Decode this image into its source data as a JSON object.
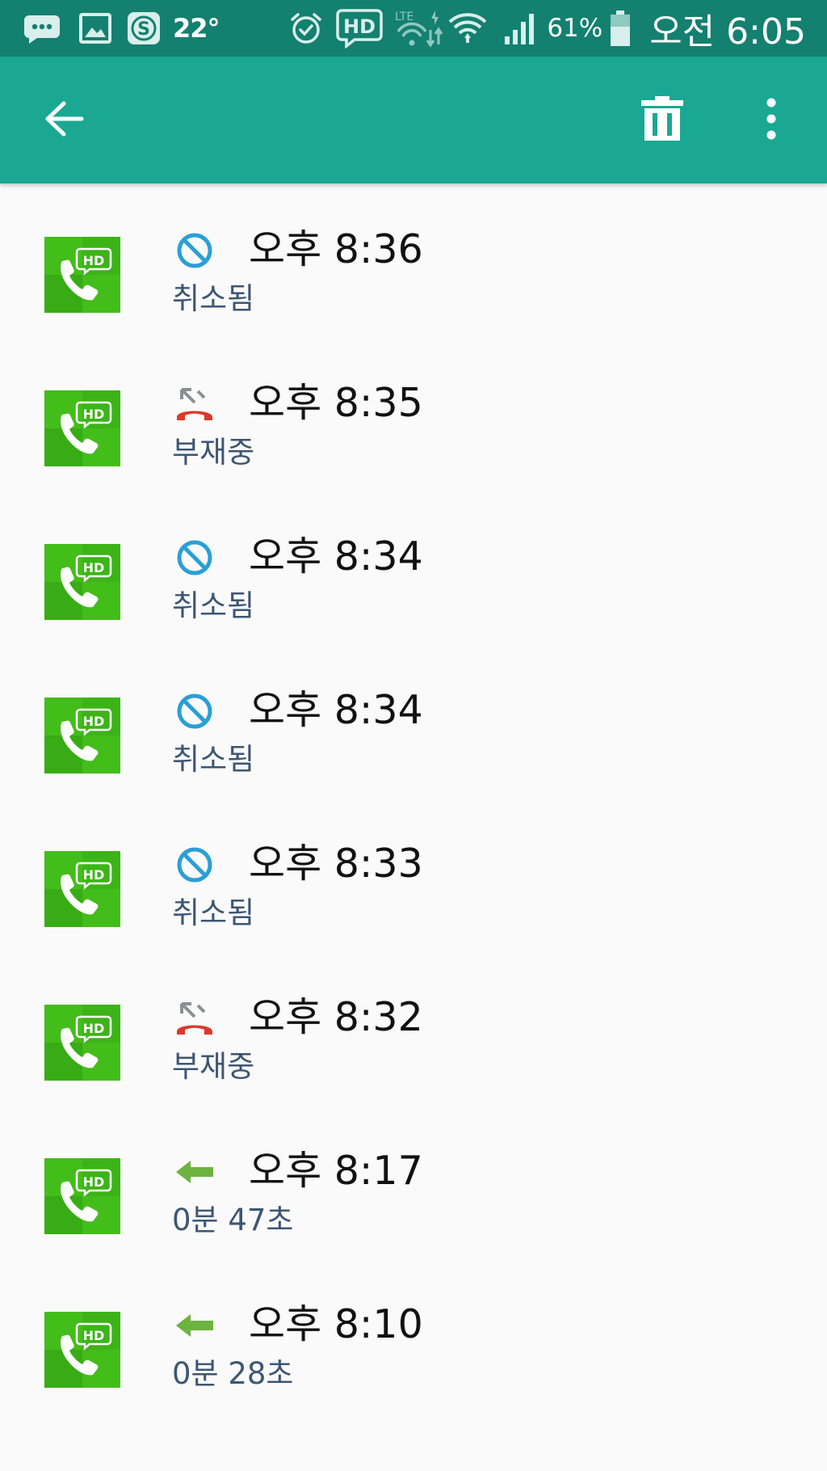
{
  "status_bar": {
    "temperature": "22°",
    "battery_percent": "61%",
    "clock": "오전 6:05",
    "network_label": "LTE",
    "hd_label": "HD",
    "battery_level": 0.61,
    "color": "#14806f"
  },
  "toolbar": {
    "color": "#1aa893",
    "back_icon": "arrow-left-icon",
    "delete_icon": "trash-icon",
    "more_icon": "more-vert-icon"
  },
  "calls": [
    {
      "time": "오후 8:36",
      "status": "취소됨",
      "type": "canceled"
    },
    {
      "time": "오후 8:35",
      "status": "부재중",
      "type": "missed"
    },
    {
      "time": "오후 8:34",
      "status": "취소됨",
      "type": "canceled"
    },
    {
      "time": "오후 8:34",
      "status": "취소됨",
      "type": "canceled"
    },
    {
      "time": "오후 8:33",
      "status": "취소됨",
      "type": "canceled"
    },
    {
      "time": "오후 8:32",
      "status": "부재중",
      "type": "missed"
    },
    {
      "time": "오후 8:17",
      "status": "0분 47초",
      "type": "incoming"
    },
    {
      "time": "오후 8:10",
      "status": "0분 28초",
      "type": "incoming"
    }
  ],
  "badge": {
    "label": "HD",
    "green_light": "#43bd1a",
    "green_dark": "#2f9e10"
  },
  "type_colors": {
    "canceled": "#2a9fd6",
    "missed": "#d93a2b",
    "incoming": "#6db33f"
  }
}
